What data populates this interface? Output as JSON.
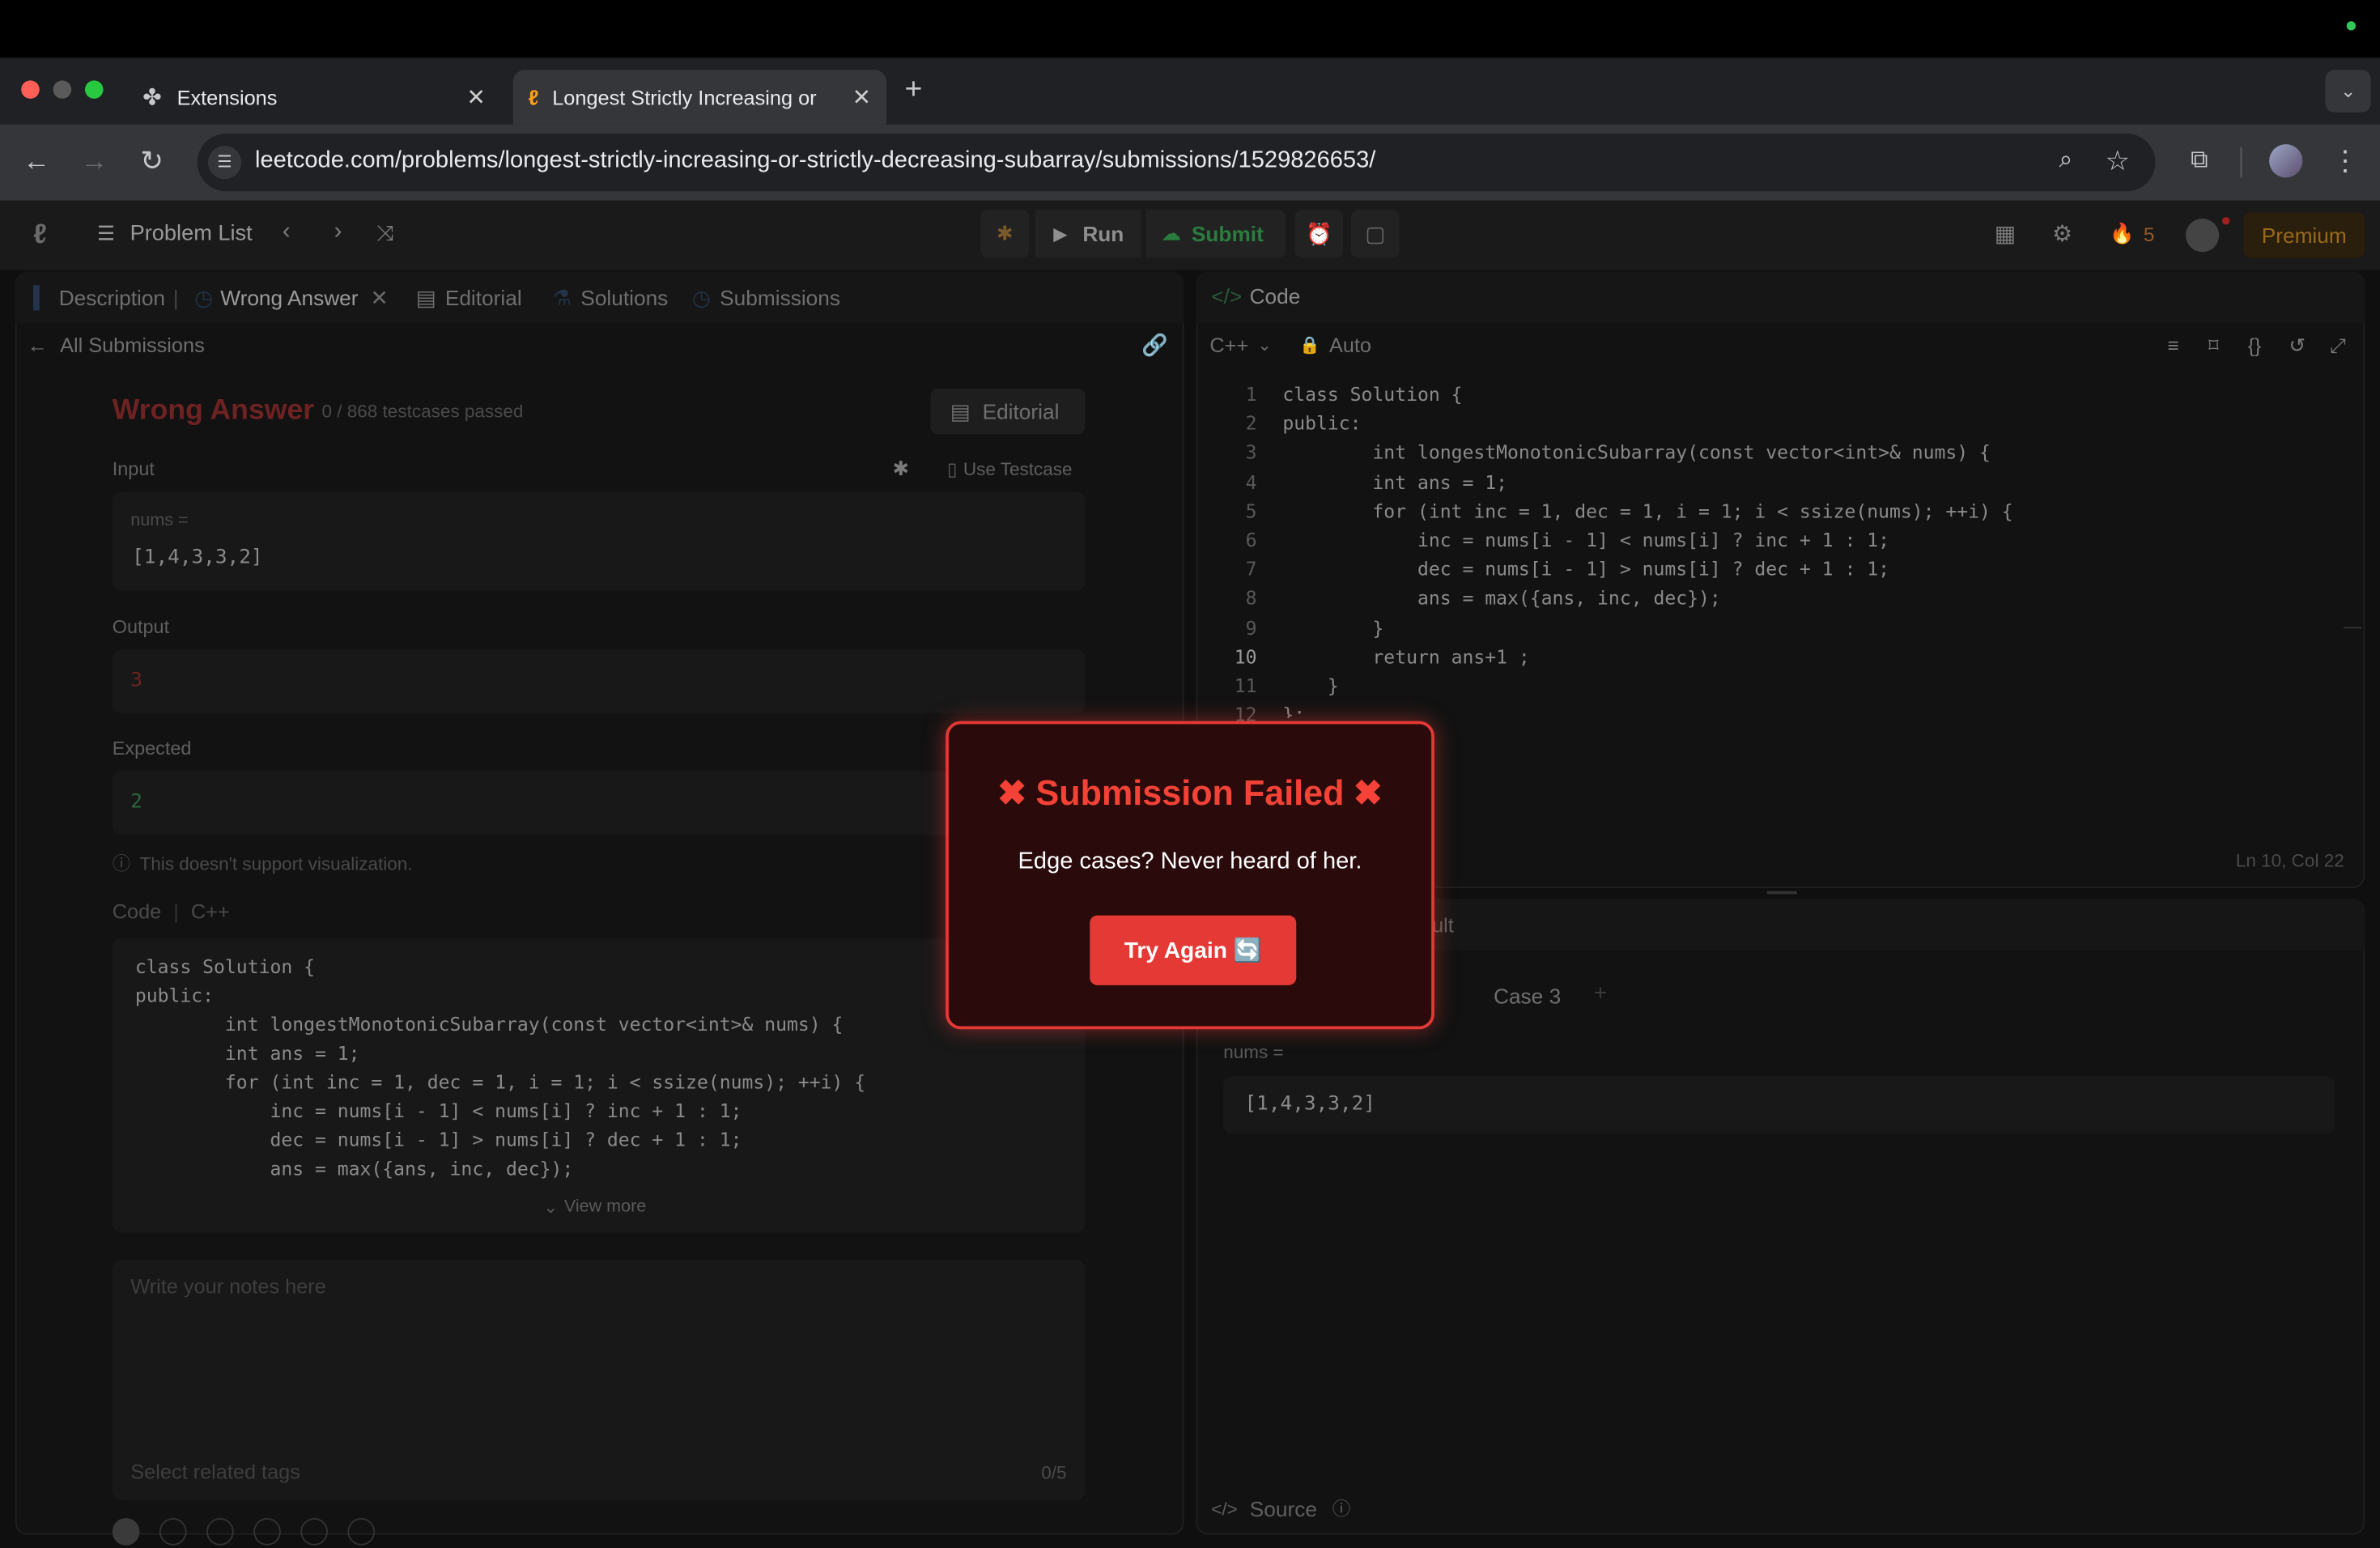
{
  "browser": {
    "tabs": [
      {
        "title": "Extensions",
        "active": false
      },
      {
        "title": "Longest Strictly Increasing or",
        "active": true
      }
    ],
    "url": "leetcode.com/problems/longest-strictly-increasing-or-strictly-decreasing-subarray/submissions/1529826653/"
  },
  "header": {
    "problem_list": "Problem List",
    "run": "Run",
    "submit": "Submit",
    "streak": "5",
    "premium": "Premium"
  },
  "left": {
    "tabs": [
      "Description",
      "Wrong Answer",
      "Editorial",
      "Solutions",
      "Submissions"
    ],
    "back": "All Submissions",
    "status": "Wrong Answer",
    "passed": "0 / 868 testcases passed",
    "editorial_btn": "Editorial",
    "input_label": "Input",
    "use_testcase": "Use Testcase",
    "var_label": "nums =",
    "input_value": "[1,4,3,3,2]",
    "output_label": "Output",
    "output_value": "3",
    "expected_label": "Expected",
    "expected_value": "2",
    "viz_note": "This doesn't support visualization.",
    "code_label": "Code",
    "code_lang": "C++",
    "code_lines": [
      "class Solution {",
      "public:",
      "        int longestMonotonicSubarray(const vector<int>& nums) {",
      "        int ans = 1;",
      "        for (int inc = 1, dec = 1, i = 1; i < ssize(nums); ++i) {",
      "            inc = nums[i - 1] < nums[i] ? inc + 1 : 1;",
      "            dec = nums[i - 1] > nums[i] ? dec + 1 : 1;",
      "            ans = max({ans, inc, dec});"
    ],
    "view_more": "View more",
    "notes_placeholder": "Write your notes here",
    "tags_placeholder": "Select related tags",
    "tags_count": "0/5"
  },
  "right": {
    "code_title": "Code",
    "lang": "C++",
    "auto": "Auto",
    "line_numbers": [
      "1",
      "2",
      "3",
      "4",
      "5",
      "6",
      "7",
      "8",
      "9",
      "10",
      "11",
      "12"
    ],
    "editor_lines": [
      "class Solution {",
      "public:",
      "        int longestMonotonicSubarray(const vector<int>& nums) {",
      "        int ans = 1;",
      "        for (int inc = 1, dec = 1, i = 1; i < ssize(nums); ++i) {",
      "            inc = nums[i - 1] < nums[i] ? inc + 1 : 1;",
      "            dec = nums[i - 1] > nums[i] ? dec + 1 : 1;",
      "            ans = max({ans, inc, dec});",
      "        }",
      "        return ans+1 ;",
      "    }",
      "};"
    ],
    "cursor": "Ln 10, Col 22",
    "result_tab": "Test Result",
    "case3": "Case 3",
    "var_label": "nums =",
    "case_value": "[1,4,3,3,2]",
    "source": "Source"
  },
  "modal": {
    "title": "Submission Failed",
    "message": "Edge cases? Never heard of her.",
    "button": "Try Again 🔄"
  }
}
